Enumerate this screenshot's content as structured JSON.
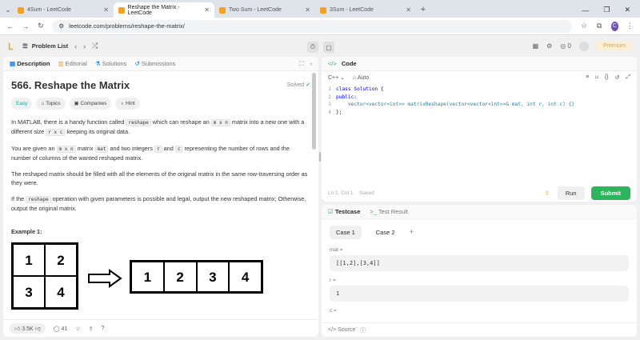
{
  "browser": {
    "tabs": [
      {
        "label": "4Sum - LeetCode",
        "active": false
      },
      {
        "label": "Reshape the Matrix - LeetCode",
        "active": true
      },
      {
        "label": "Two Sum - LeetCode",
        "active": false
      },
      {
        "label": "3Sum - LeetCode",
        "active": false
      }
    ],
    "url": "leetcode.com/problems/reshape-the-matrix/",
    "profile_initial": "C"
  },
  "topbar": {
    "problem_list": "Problem List",
    "coins": "0",
    "premium": "Premium"
  },
  "left": {
    "tabs": [
      "Description",
      "Editorial",
      "Solutions",
      "Submissions"
    ],
    "title": "566. Reshape the Matrix",
    "solved": "Solved",
    "chips": [
      "Easy",
      "Topics",
      "Companies",
      "Hint"
    ],
    "p1a": "In MATLAB, there is a handy function called ",
    "p1code": "reshape",
    "p1b": " which can reshape an ",
    "p1code2": "m x n",
    "p1c": " matrix into a new one with a different size ",
    "p1code3": "r x c",
    "p1d": " keeping its original data.",
    "p2a": "You are given an ",
    "p2code": "m x n",
    "p2b": " matrix ",
    "p2code2": "mat",
    "p2c": " and two integers ",
    "p2code3": "r",
    "p2d": " and ",
    "p2code4": "c",
    "p2e": " representing the number of rows and the number of columns of the wanted reshaped matrix.",
    "p3": "The reshaped matrix should be filled with all the elements of the original matrix in the same row-traversing order as they were.",
    "p4a": "If the ",
    "p4code": "reshape",
    "p4b": " operation with given parameters is possible and legal, output the new reshaped matrix; Otherwise, output the original matrix.",
    "example": "Example 1:",
    "grid_in": [
      "1",
      "2",
      "3",
      "4"
    ],
    "grid_out": [
      "1",
      "2",
      "3",
      "4"
    ],
    "likes": "3.5K",
    "comments": "41"
  },
  "code": {
    "title": "Code",
    "lang": "C++",
    "auto": "Auto",
    "lines": [
      {
        "n": "1",
        "text": "class Solution {"
      },
      {
        "n": "2",
        "text": "public:"
      },
      {
        "n": "3",
        "text": "    vector<vector<int>> matrixReshape(vector<vector<int>>& mat, int r, int c) {}"
      },
      {
        "n": "4",
        "text": "};"
      }
    ],
    "status": "Ln 1, Col 1",
    "saved": "Saved",
    "run": "Run",
    "submit": "Submit"
  },
  "test": {
    "tab1": "Testcase",
    "tab2": "Test Result",
    "cases": [
      "Case 1",
      "Case 2"
    ],
    "mat_label": "mat =",
    "mat_value": "[[1,2],[3,4]]",
    "r_label": "r =",
    "r_value": "1",
    "c_label": "c =",
    "source": "Source"
  }
}
